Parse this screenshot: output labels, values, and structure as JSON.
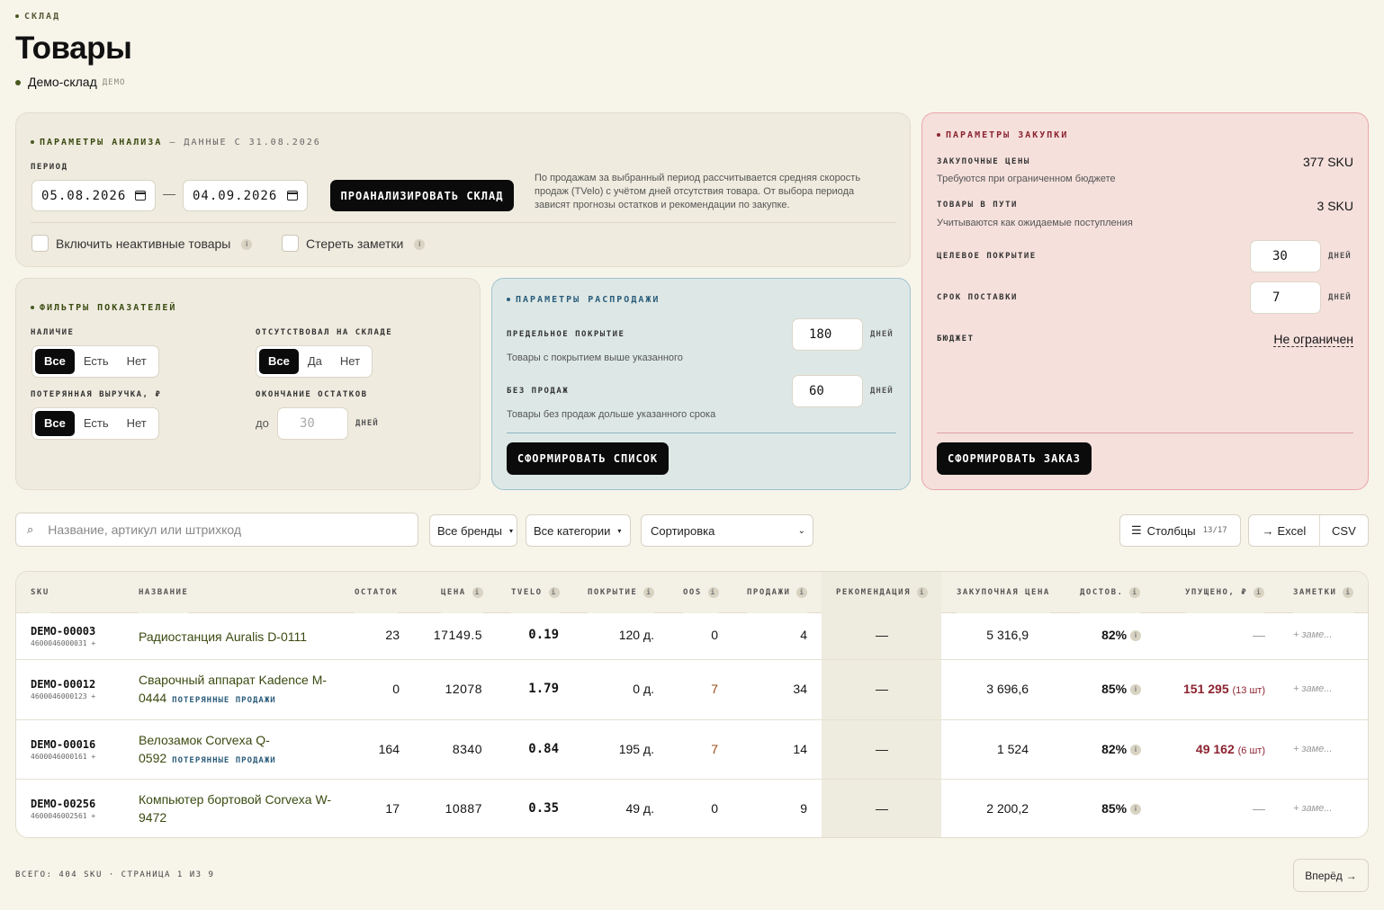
{
  "header": {
    "eyebrow": "СКЛАД",
    "title": "Товары",
    "warehouse": "Демо-склад",
    "warehouse_badge": "ДЕМО"
  },
  "analysis": {
    "title": "ПАРАМЕТРЫ АНАЛИЗА",
    "title_suffix": "— ДАННЫЕ С 31.08.2026",
    "period_label": "ПЕРИОД",
    "date_from": "05.08.2026",
    "date_to": "04.09.2026",
    "dash": "—",
    "analyze_label": "ПРОАНАЛИЗИРОВАТЬ СКЛАД",
    "note": "По продажам за выбранный период рассчитывается средняя скорость продаж (TVelo) с учётом дней отсутствия товара. От выбора периода зависят прогнозы остатков и рекомендации по закупке.",
    "include_inactive": "Включить неактивные товары",
    "erase_notes": "Стереть заметки",
    "info_glyph": "i"
  },
  "filters": {
    "title": "ФИЛЬТРЫ ПОКАЗАТЕЛЕЙ",
    "availability_label": "НАЛИЧИЕ",
    "availability_options": [
      "Все",
      "Есть",
      "Нет"
    ],
    "oos_label": "ОТСУТСТВОВАЛ НА СКЛАДЕ",
    "oos_options": [
      "Все",
      "Да",
      "Нет"
    ],
    "lost_label": "ПОТЕРЯННАЯ ВЫРУЧКА, ₽",
    "lost_options": [
      "Все",
      "Есть",
      "Нет"
    ],
    "ending_label": "ОКОНЧАНИЕ ОСТАТКОВ",
    "ending_prefix": "до",
    "ending_placeholder": "30",
    "ending_unit": "ДНЕЙ"
  },
  "sale": {
    "title": "ПАРАМЕТРЫ РАСПРОДАЖИ",
    "limit_label": "ПРЕДЕЛЬНОЕ ПОКРЫТИЕ",
    "limit_value": "180",
    "limit_hint": "Товары с покрытием выше указанного",
    "nosales_label": "БЕЗ ПРОДАЖ",
    "nosales_value": "60",
    "nosales_hint": "Товары без продаж дольше указанного срока",
    "unit": "ДНЕЙ",
    "button": "СФОРМИРОВАТЬ СПИСОК"
  },
  "purchase": {
    "title": "ПАРАМЕТРЫ ЗАКУПКИ",
    "prices_label": "ЗАКУПОЧНЫЕ ЦЕНЫ",
    "prices_value": "377 SKU",
    "prices_hint": "Требуются при ограниченном бюджете",
    "transit_label": "ТОВАРЫ В ПУТИ",
    "transit_value": "3 SKU",
    "transit_hint": "Учитываются как ожидаемые поступления",
    "coverage_label": "ЦЕЛЕВОЕ ПОКРЫТИЕ",
    "coverage_value": "30",
    "lead_label": "СРОК ПОСТАВКИ",
    "lead_value": "7",
    "unit": "ДНЕЙ",
    "budget_label": "БЮДЖЕТ",
    "budget_value": "Не ограничен",
    "button": "СФОРМИРОВАТЬ ЗАКАЗ"
  },
  "toolbar": {
    "search_placeholder": "Название, артикул или штрихкод",
    "brands": "Все бренды",
    "categories": "Все категории",
    "sort": "Сортировка",
    "columns": "Столбцы",
    "columns_count": "13/17",
    "excel": "Excel",
    "csv": "CSV"
  },
  "table": {
    "headers": [
      "SKU",
      "НАЗВАНИЕ",
      "ОСТАТОК",
      "ЦЕНА",
      "TVELO",
      "ПОКРЫТИЕ",
      "OOS",
      "ПРОДАЖИ",
      "РЕКОМЕНДАЦИЯ",
      "ЗАКУПОЧНАЯ ЦЕНА",
      "ДОСТОВ.",
      "УПУЩЕНО, ₽",
      "ЗАМЕТКИ"
    ],
    "rows": [
      {
        "sku": "DEMO-00003",
        "barcode": "4600046000031 +",
        "name": "Радиостанция Auralis D-0111",
        "tag": "",
        "stock": "23",
        "price": "17149.5",
        "tvelo": "0.19",
        "coverage": "120 д.",
        "oos": "0",
        "sales": "4",
        "rec": "—",
        "purchase": "5 316,9",
        "rel": "82%",
        "lost": "—",
        "lost_qty": "",
        "notes": "+ заме..."
      },
      {
        "sku": "DEMO-00012",
        "barcode": "4600046000123 +",
        "name": "Сварочный аппарат Kadence M-0444",
        "tag": "ПОТЕРЯННЫЕ ПРОДАЖИ",
        "stock": "0",
        "price": "12078",
        "tvelo": "1.79",
        "coverage": "0 д.",
        "oos": "7",
        "sales": "34",
        "rec": "—",
        "purchase": "3 696,6",
        "rel": "85%",
        "lost": "151 295",
        "lost_qty": "(13 шт)",
        "notes": "+ заме..."
      },
      {
        "sku": "DEMO-00016",
        "barcode": "4600046000161 +",
        "name": "Велозамок Corvexa Q-0592",
        "tag": "ПОТЕРЯННЫЕ ПРОДАЖИ",
        "stock": "164",
        "price": "8340",
        "tvelo": "0.84",
        "coverage": "195 д.",
        "oos": "7",
        "sales": "14",
        "rec": "—",
        "purchase": "1 524",
        "rel": "82%",
        "lost": "49 162",
        "lost_qty": "(6 шт)",
        "notes": "+ заме..."
      },
      {
        "sku": "DEMO-00256",
        "barcode": "4600046002561 +",
        "name": "Компьютер бортовой Corvexa W-9472",
        "tag": "",
        "stock": "17",
        "price": "10887",
        "tvelo": "0.35",
        "coverage": "49 д.",
        "oos": "0",
        "sales": "9",
        "rec": "—",
        "purchase": "2 200,2",
        "rel": "85%",
        "lost": "—",
        "lost_qty": "",
        "notes": "+ заме..."
      }
    ]
  },
  "footer": {
    "summary": "ВСЕГО: 404 SKU · СТРАНИЦА 1 ИЗ 9",
    "next": "Вперёд"
  },
  "colors": {
    "accent_dark": "#0b0b0b",
    "olive": "#4a5a20",
    "lost_red": "#8c2330",
    "sale_blue": "#dde8e6",
    "purchase_pink": "#f5e0dc"
  }
}
